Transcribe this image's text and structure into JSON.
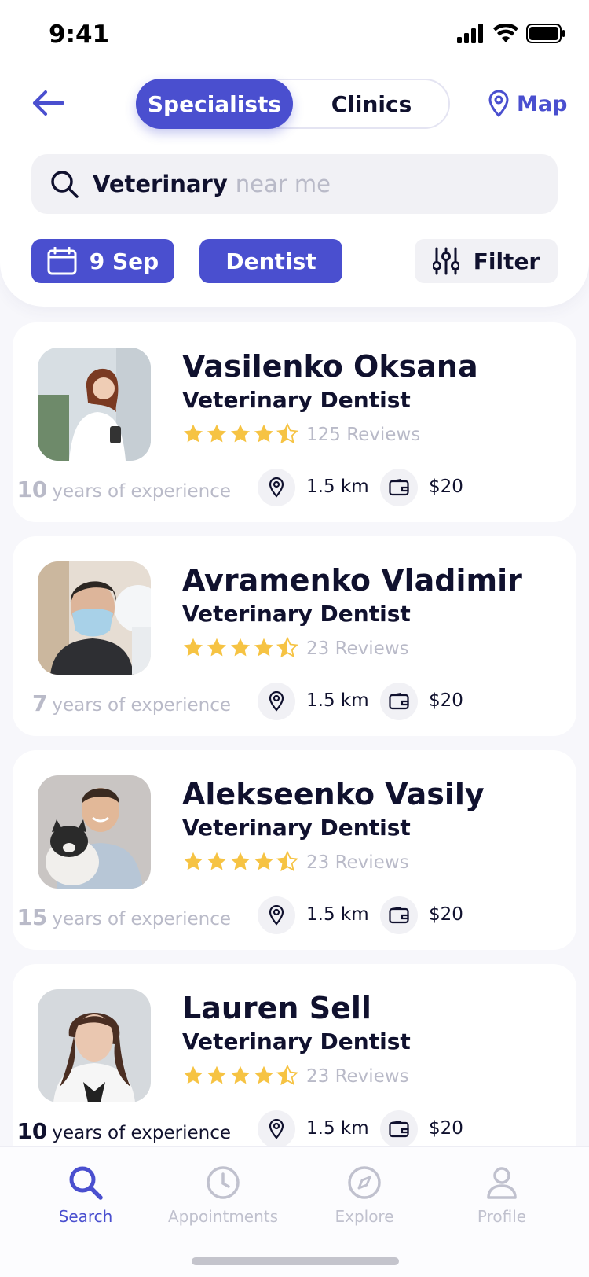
{
  "status_bar": {
    "time": "9:41"
  },
  "header": {
    "segments": [
      "Specialists",
      "Clinics"
    ],
    "active_segment": "Specialists",
    "map_label": "Map"
  },
  "search": {
    "value": "Veterinary",
    "placeholder": "near me"
  },
  "filters": {
    "date": "9 Sep",
    "specialty": "Dentist",
    "filter_label": "Filter"
  },
  "colors": {
    "accent": "#4A4FCF",
    "star": "#F6C343",
    "muted_text": "#B9BAC8",
    "dark_text": "#10112E",
    "chip_bg": "#F1F1F5"
  },
  "specialists": [
    {
      "name": "Vasilenko Oksana",
      "specialty": "Veterinary Dentist",
      "rating": 4.5,
      "reviews": "125 Reviews",
      "experience_years": "10",
      "experience_label": "years of experience",
      "distance": "1.5 km",
      "price": "$20"
    },
    {
      "name": "Avramenko Vladimir",
      "specialty": "Veterinary Dentist",
      "rating": 4.5,
      "reviews": "23 Reviews",
      "experience_years": "7",
      "experience_label": "years of experience",
      "distance": "1.5 km",
      "price": "$20"
    },
    {
      "name": "Alekseenko Vasily",
      "specialty": "Veterinary Dentist",
      "rating": 4.5,
      "reviews": "23 Reviews",
      "experience_years": "15",
      "experience_label": "years of experience",
      "distance": "1.5 km",
      "price": "$20"
    },
    {
      "name": "Lauren Sell",
      "specialty": "Veterinary Dentist",
      "rating": 4.5,
      "reviews": "23 Reviews",
      "experience_years": "10",
      "experience_label": "years of experience",
      "distance": "1.5 km",
      "price": "$20"
    }
  ],
  "tabbar": {
    "tabs": [
      {
        "label": "Search",
        "icon": "search-icon",
        "active": true
      },
      {
        "label": "Appointments",
        "icon": "clock-icon",
        "active": false
      },
      {
        "label": "Explore",
        "icon": "compass-icon",
        "active": false
      },
      {
        "label": "Profile",
        "icon": "person-icon",
        "active": false
      }
    ]
  }
}
